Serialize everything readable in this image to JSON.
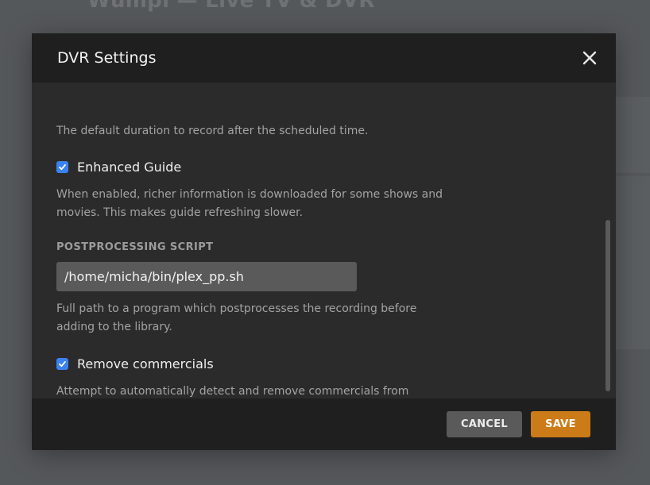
{
  "background": {
    "title": "Wumpi — Live TV & DVR"
  },
  "dialog": {
    "title": "DVR Settings"
  },
  "settings": {
    "end_padding_help": "The default duration to record after the scheduled time.",
    "enhanced_guide": {
      "label": "Enhanced Guide",
      "checked": true,
      "help": "When enabled, richer information is downloaded for some shows and movies. This makes guide refreshing slower."
    },
    "postprocessing": {
      "label": "POSTPROCESSING SCRIPT",
      "value": "/home/micha/bin/plex_pp.sh",
      "help": "Full path to a program which postprocesses the recording before adding to the library."
    },
    "remove_commercials": {
      "label": "Remove commercials",
      "checked": true,
      "help": "Attempt to automatically detect and remove commercials from recordings. This process may take a long time and cause high CPU usage. Portions of your recordings detected as commercials will be completely removed from"
    }
  },
  "footer": {
    "cancel_label": "CANCEL",
    "save_label": "SAVE"
  },
  "colors": {
    "checkbox": "#3b82f0",
    "save_button": "#cc7b19",
    "modal_body": "#2b2b2b",
    "modal_header": "#1f1f1f"
  },
  "icons": {
    "close": "close-icon",
    "check": "checkmark-icon"
  }
}
